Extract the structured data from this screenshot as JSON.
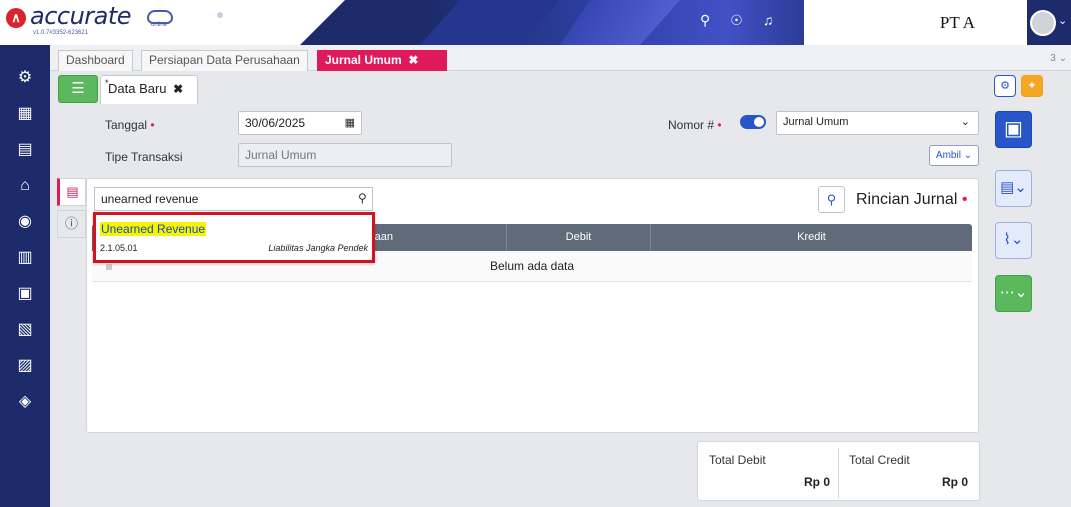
{
  "brand": {
    "name": "accurate",
    "sub": "online",
    "version": "v1.0.7#3352-623621"
  },
  "company": "PT A",
  "tabs": [
    {
      "label": "Dashboard"
    },
    {
      "label": "Persiapan Data Perusahaan"
    },
    {
      "label": "Jurnal Umum",
      "close": "✖"
    }
  ],
  "tab_count": "3 ⌄",
  "subtab": {
    "marker": "*",
    "label": "Data Baru",
    "close": "✖"
  },
  "form": {
    "tanggal_label": "Tanggal",
    "required_mark": "•",
    "tanggal_value": "30/06/2025",
    "tipe_label": "Tipe Transaksi",
    "tipe_value": "Jurnal Umum",
    "nomor_label": "Nomor #",
    "nomor_value": "Jurnal Umum",
    "ambil_label": "Ambil ⌄"
  },
  "search": {
    "value": "unearned revenue"
  },
  "rincian_title": "Rincian Jurnal",
  "dropdown": {
    "name": "Unearned Revenue",
    "code": "2.1.05.01",
    "type": "Liabilitas Jangka Pendek"
  },
  "grid": {
    "partial_header": "raan",
    "debit_header": "Debit",
    "kredit_header": "Kredit",
    "empty": "Belum ada data"
  },
  "totals": {
    "debit_label": "Total Debit",
    "debit_value": "Rp 0",
    "credit_label": "Total Credit",
    "credit_value": "Rp 0"
  },
  "colors": {
    "primary": "#1d2b6b",
    "accent": "#e0195b",
    "save": "#2756c9",
    "success": "#5cb85c",
    "highlight": "#f5f500",
    "callout": "#d8111e"
  }
}
